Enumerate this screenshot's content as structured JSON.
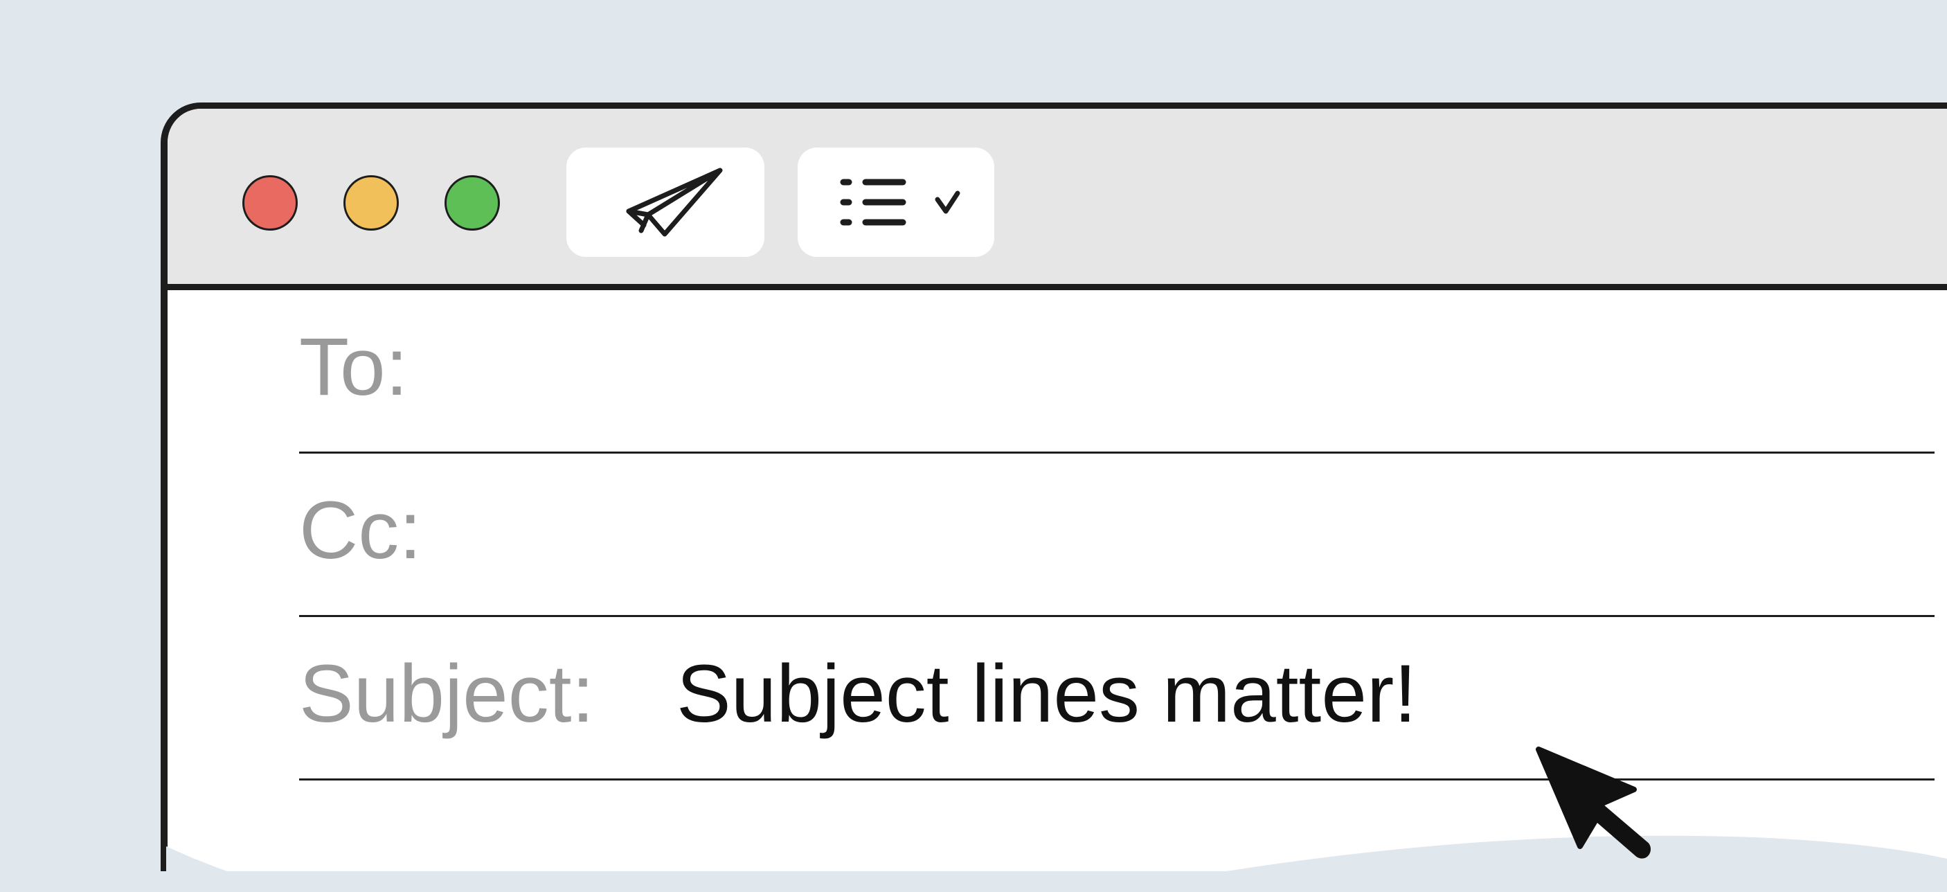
{
  "window": {
    "traffic_lights": {
      "close_color": "#e86a60",
      "minimize_color": "#f2c05a",
      "maximize_color": "#5fbf57"
    },
    "toolbar": {
      "send_icon": "paper-plane-icon",
      "format_icon": "list-icon",
      "format_dropdown_icon": "chevron-down-icon"
    }
  },
  "form": {
    "to": {
      "label": "To:",
      "value": ""
    },
    "cc": {
      "label": "Cc:",
      "value": ""
    },
    "subject": {
      "label": "Subject:",
      "value": "Subject lines matter!"
    }
  },
  "cursor": {
    "icon": "mouse-pointer-icon"
  }
}
